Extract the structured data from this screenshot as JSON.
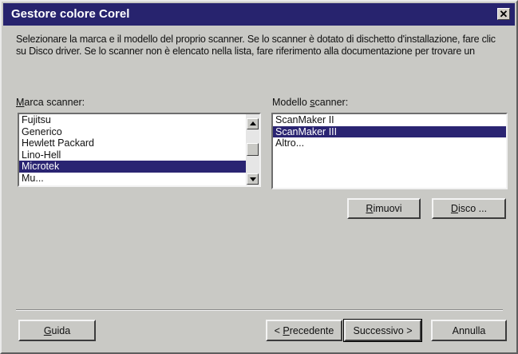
{
  "window": {
    "title": "Gestore colore Corel",
    "close_glyph": "✕"
  },
  "intro": {
    "text": "Selezionare la marca e il modello del proprio scanner.  Se lo scanner è dotato di dischetto d'installazione, fare clic su Disco driver.  Se lo scanner non è elencato nella lista, fare riferimento alla documentazione per trovare un"
  },
  "brand": {
    "label_mnemonic": "M",
    "label_rest": "arca scanner:",
    "items": [
      "Fujitsu",
      "Generico",
      "Hewlett Packard",
      "Lino-Hell",
      "Microtek",
      "Mu..."
    ],
    "selected": "Microtek"
  },
  "model": {
    "label_prefix": "Modello ",
    "label_mnemonic": "s",
    "label_rest": "canner:",
    "items": [
      "ScanMaker II",
      "ScanMaker III",
      "Altro..."
    ],
    "selected": "ScanMaker III"
  },
  "buttons": {
    "remove": {
      "mnemonic": "R",
      "rest": "imuovi"
    },
    "disk": {
      "mnemonic": "D",
      "rest": "isco ..."
    },
    "help": {
      "mnemonic": "G",
      "rest": "uida"
    },
    "back": {
      "prefix": "< ",
      "mnemonic": "P",
      "rest": "recedente"
    },
    "next": {
      "label": "Successivo >"
    },
    "cancel": {
      "label": "Annulla"
    }
  },
  "colors": {
    "titlebar": "#27236e",
    "selection": "#2a2472",
    "face": "#c9c9c5"
  }
}
